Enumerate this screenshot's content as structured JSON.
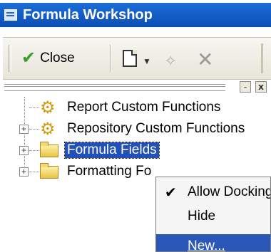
{
  "window": {
    "title": "Formula Workshop"
  },
  "toolbar": {
    "close_label": "Close",
    "icons": [
      "check-icon",
      "new-document-icon",
      "dropdown-arrow-icon",
      "wand-icon",
      "delete-icon"
    ]
  },
  "panel": {
    "pin_glyph": "-",
    "close_glyph": "x"
  },
  "tree": {
    "items": [
      {
        "label": "Report Custom Functions",
        "icon": "gear-icon",
        "expandable": false
      },
      {
        "label": "Repository Custom Functions",
        "icon": "gear-icon",
        "expandable": true
      },
      {
        "label": "Formula Fields",
        "icon": "folder-icon",
        "expandable": true,
        "selected": true
      },
      {
        "label": "Formatting Fo",
        "icon": "folder-icon",
        "expandable": true
      }
    ]
  },
  "context_menu": {
    "items": [
      {
        "label": "Allow Docking",
        "checked": true
      },
      {
        "label": "Hide",
        "checked": false
      },
      {
        "label": "New...",
        "highlighted": true
      }
    ]
  },
  "colors": {
    "titlebar": "#0b4fb5",
    "selection": "#2050b8",
    "menu_highlight": "#2b57b6"
  }
}
